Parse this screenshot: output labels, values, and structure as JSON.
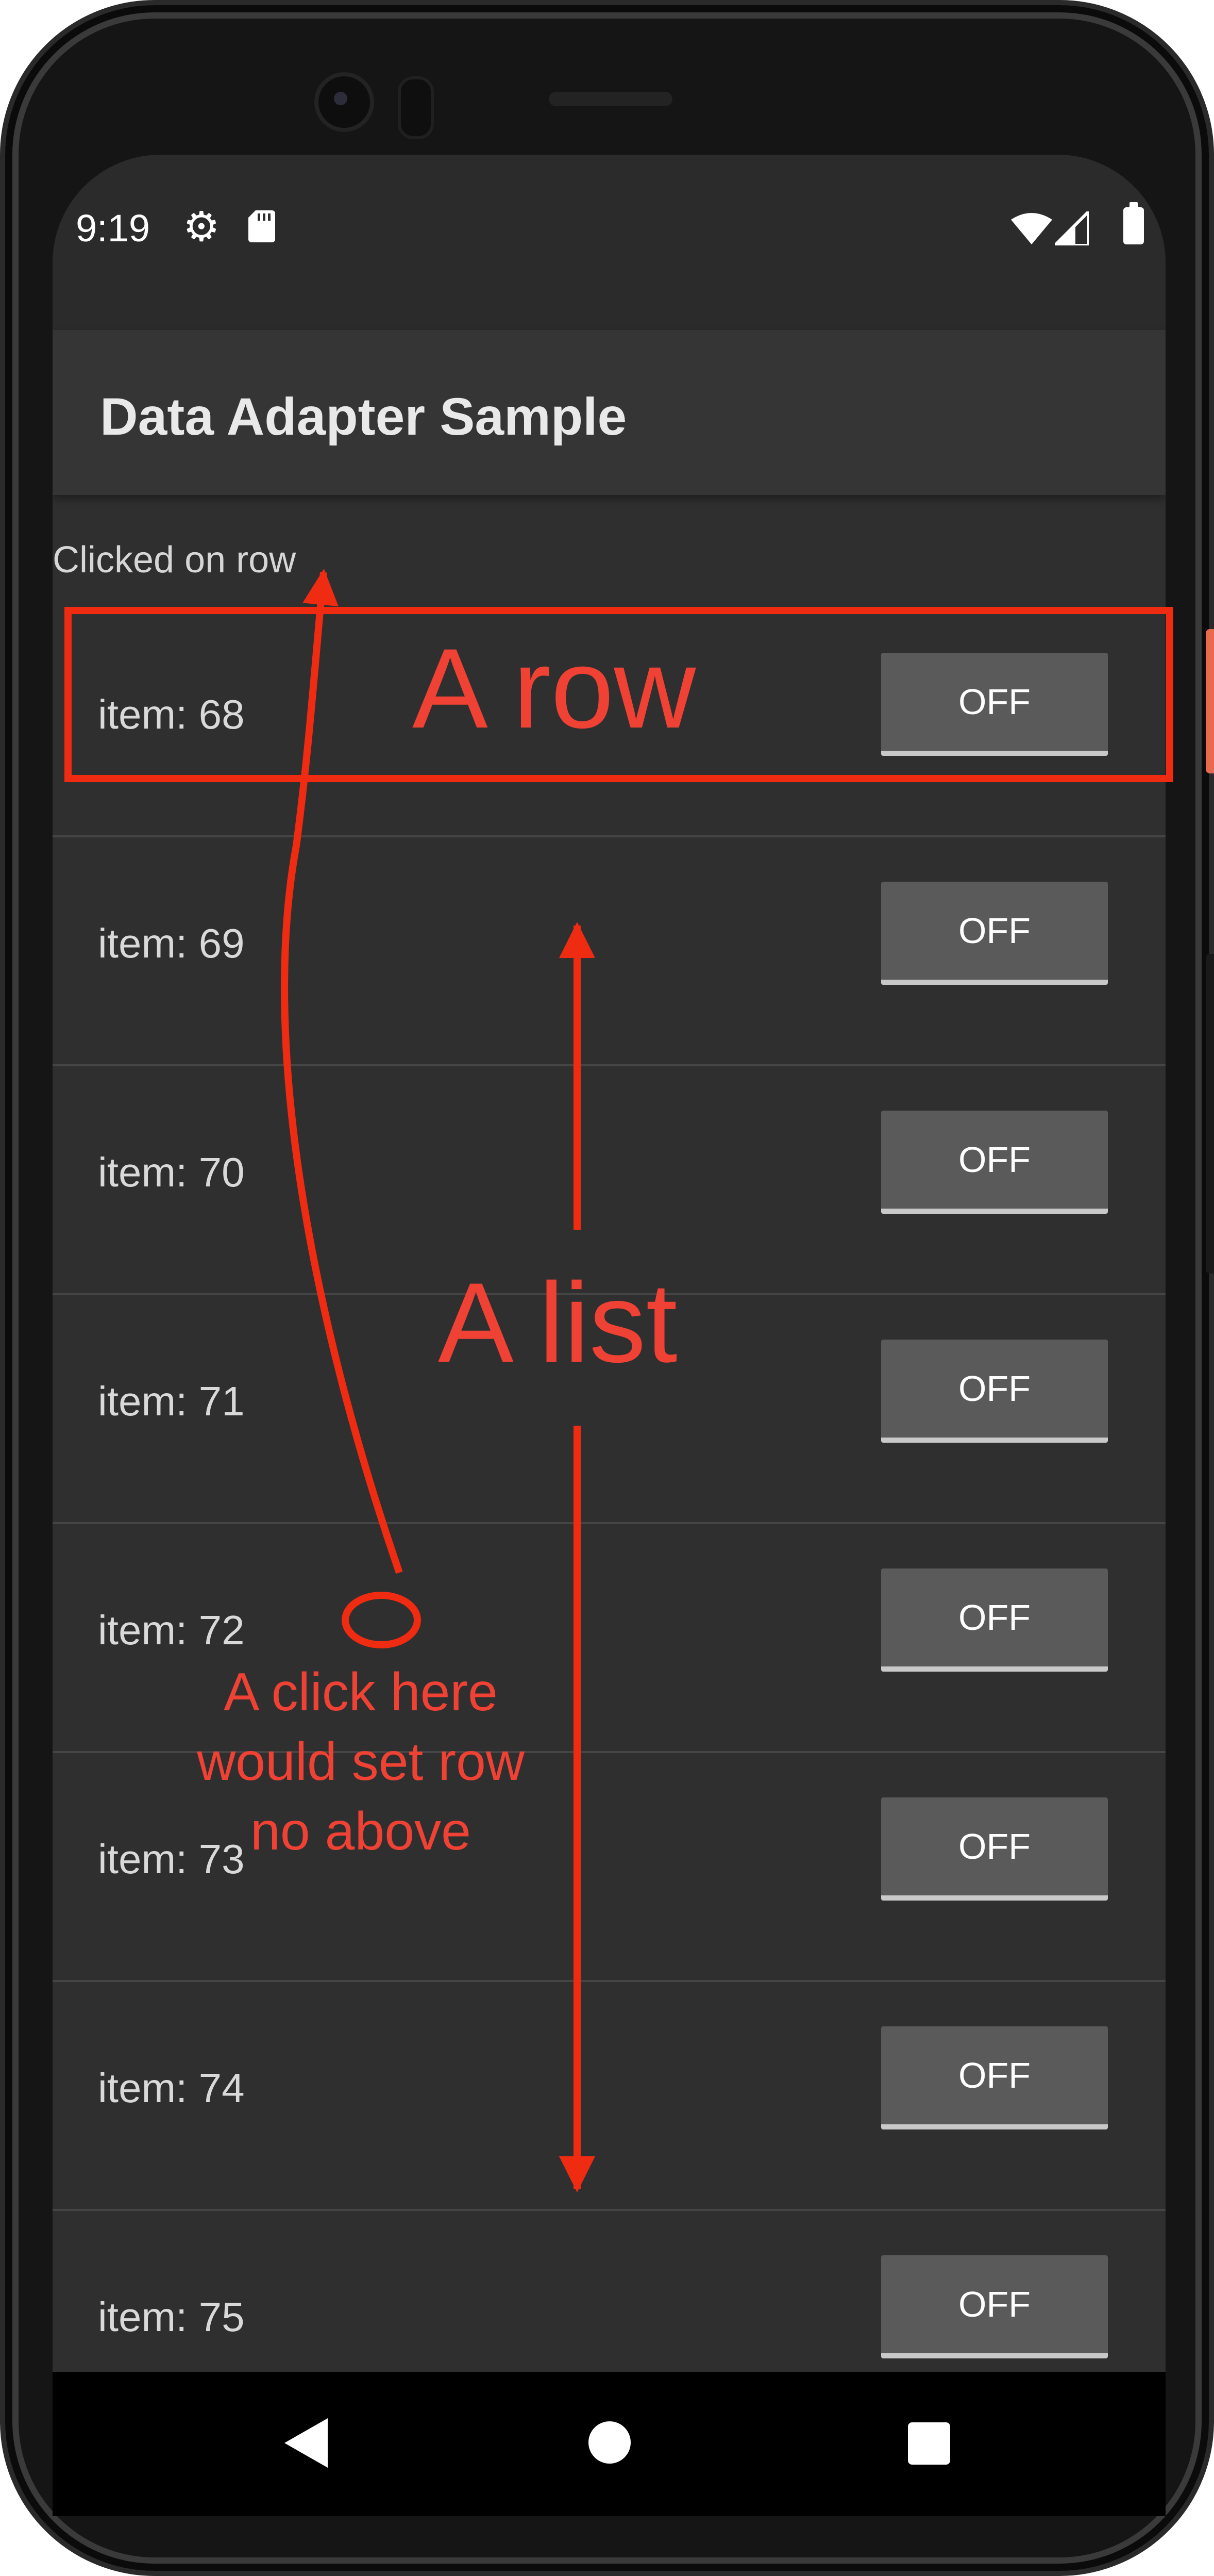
{
  "status_bar": {
    "time": "9:19"
  },
  "app_bar": {
    "title": "Data Adapter Sample"
  },
  "main": {
    "clicked_text": "Clicked on row",
    "rows": [
      {
        "label": "item: 68",
        "toggle": "OFF"
      },
      {
        "label": "item: 69",
        "toggle": "OFF"
      },
      {
        "label": "item: 70",
        "toggle": "OFF"
      },
      {
        "label": "item: 71",
        "toggle": "OFF"
      },
      {
        "label": "item: 72",
        "toggle": "OFF"
      },
      {
        "label": "item: 73",
        "toggle": "OFF"
      },
      {
        "label": "item: 74",
        "toggle": "OFF"
      },
      {
        "label": "item: 75",
        "toggle": "OFF"
      }
    ]
  },
  "annotations": {
    "row_label": "A row",
    "list_label": "A list",
    "click_note": "A click here would set row no above",
    "color": "#ef4134"
  },
  "icons": [
    "gear-icon",
    "sd-card-icon",
    "wifi-icon",
    "signal-icon",
    "battery-icon",
    "back-icon",
    "home-icon",
    "recent-apps-icon"
  ]
}
